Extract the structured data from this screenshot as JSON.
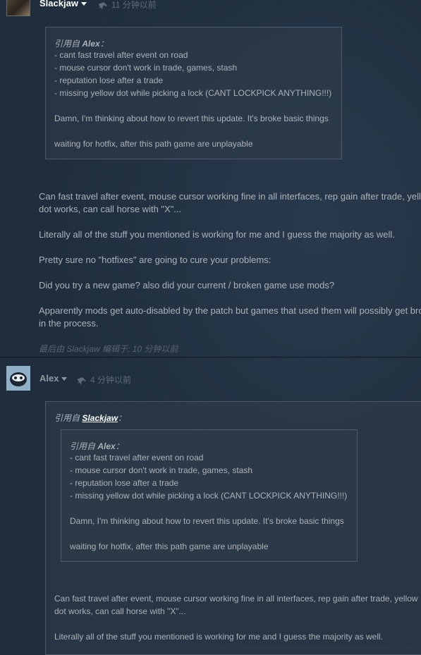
{
  "post1": {
    "author": "Slackjaw",
    "time": "11 分钟以前",
    "quote": {
      "prefix": "引用自 ",
      "source": "Alex",
      "suffix": "：",
      "lines": [
        "- cant fast travel after event on road",
        "- mouse cursor don't work in trade, games, stash",
        "- reputation lose after a trade",
        "- missing yellow dot while picking a lock (CANT LOCKPICK ANYTHING!!!)",
        "Damn, I'm thinking about how to revert this update. It's broke basic things",
        "waiting for hotfix, after this path game are unplayable"
      ]
    },
    "body": [
      "Can fast travel after event, mouse cursor working fine in all interfaces, rep gain after trade, yell",
      "dot works, can call horse with \"X\"...",
      "Literally all of the stuff you mentioned is working for me and I guess the majority as well.",
      "Pretty sure no \"hotfixes\" are going to cure your problems:",
      "Did you try a new game? also did your current / broken game use mods?",
      "Apparently mods get auto-disabled by the patch but games that used them will possibly get bro",
      "in the process."
    ],
    "edited": "最后由 Slackjaw 编辑于: 10 分钟以前"
  },
  "post2": {
    "author": "Alex",
    "time": "4 分钟以前",
    "quote": {
      "prefix": "引用自 ",
      "source": "Slackjaw",
      "suffix": "：",
      "nested": {
        "prefix": "引用自 ",
        "source": "Alex",
        "suffix": "：",
        "lines": [
          "- cant fast travel after event on road",
          "- mouse cursor don't work in trade, games, stash",
          "- reputation lose after a trade",
          "- missing yellow dot while picking a lock (CANT LOCKPICK ANYTHING!!!)",
          "Damn, I'm thinking about how to revert this update. It's broke basic things",
          "waiting for hotfix, after this path game are unplayable"
        ]
      },
      "lines": [
        "Can fast travel after event, mouse cursor working fine in all interfaces, rep gain after trade, yellow",
        "dot works, can call horse with \"X\"...",
        "Literally all of the stuff you mentioned is working for me and I guess the majority as well."
      ]
    }
  },
  "colors": {
    "background": "#1f2d3d",
    "author1": "#ffffff",
    "author2": "#8f98a0",
    "text": "#acb2b8",
    "muted": "#5e6a74"
  },
  "icons": [
    "caret-down-icon",
    "pin-icon"
  ]
}
